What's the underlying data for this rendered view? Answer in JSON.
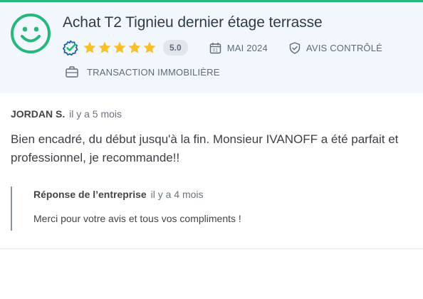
{
  "review": {
    "title": "Achat T2 Tignieu dernier étage terrasse",
    "rating": 5,
    "score_label": "5.0",
    "date": "MAI 2024",
    "verified_label": "AVIS CONTRÔLÉ",
    "category": "TRANSACTION IMMOBILIÈRE",
    "author": "JORDAN S.",
    "posted_ago": "il y a 5 mois",
    "text": "Bien encadré, du début jusqu'à la fin. Monsieur IVANOFF a été parfait et professionnel, je recommande!!"
  },
  "reply": {
    "author": "Réponse de l’entreprise",
    "posted_ago": "il y a 4 mois",
    "text": "Merci pour votre avis et tous vos compliments !"
  },
  "colors": {
    "accent_green": "#27b77b",
    "star_yellow": "#f7c02a",
    "header_bg": "#f1f7fc",
    "check_blue": "#1f5fa8"
  },
  "icons": {
    "sentiment": "smiley-icon",
    "verified": "verified-check-icon",
    "date": "calendar-icon",
    "controlled": "shield-check-icon",
    "category": "briefcase-icon"
  }
}
